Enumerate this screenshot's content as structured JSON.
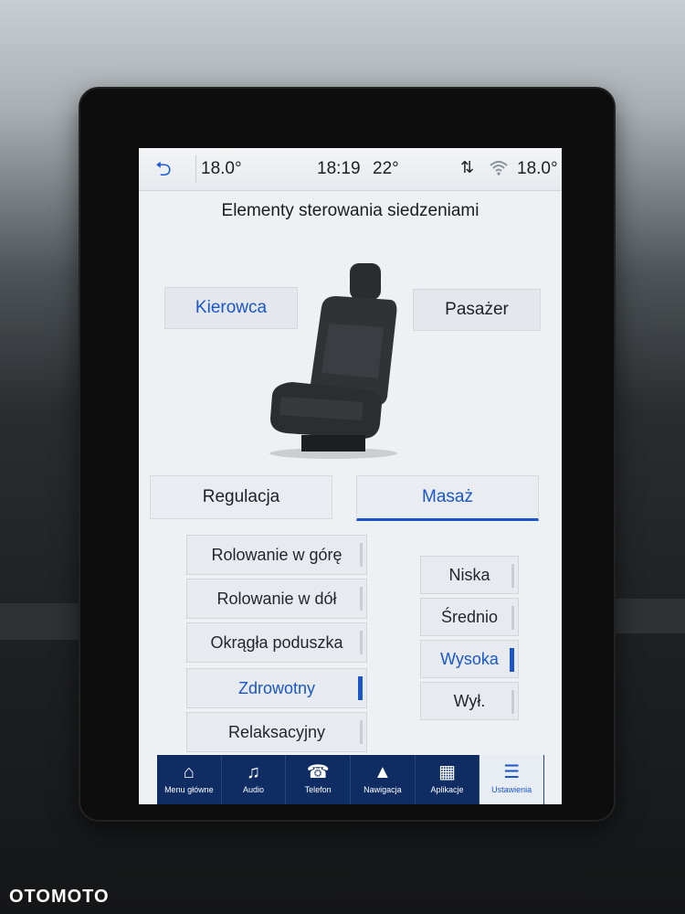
{
  "status_bar": {
    "back_icon": "back-arrow-icon",
    "temp_left": "18.0°",
    "clock": "18:19",
    "outside_temp": "22°",
    "temp_right": "18.0°"
  },
  "title": "Elementy sterowania siedzeniami",
  "seat_select": {
    "driver": "Kierowca",
    "passenger": "Pasażer",
    "selected": "driver"
  },
  "tabs": [
    {
      "label": "Regulacja"
    },
    {
      "label": "Masaż"
    }
  ],
  "massage_programs": [
    {
      "label": "Rolowanie w górę"
    },
    {
      "label": "Rolowanie w dół"
    },
    {
      "label": "Okrągła poduszka"
    },
    {
      "label": "Zdrowotny"
    },
    {
      "label": "Relaksacyjny"
    }
  ],
  "intensity_levels": [
    {
      "label": "Niska"
    },
    {
      "label": "Średnio"
    },
    {
      "label": "Wysoka"
    },
    {
      "label": "Wył."
    }
  ],
  "nav": [
    {
      "label": "Menu główne",
      "icon": "home-icon"
    },
    {
      "label": "Audio",
      "icon": "music-note-icon"
    },
    {
      "label": "Telefon",
      "icon": "phone-icon"
    },
    {
      "label": "Nawigacja",
      "icon": "navigation-icon"
    },
    {
      "label": "Aplikacje",
      "icon": "apps-grid-icon"
    },
    {
      "label": "Ustawienia",
      "icon": "settings-icon"
    }
  ],
  "accent_color": "#1a56c9",
  "watermark": "OTOMOTO"
}
